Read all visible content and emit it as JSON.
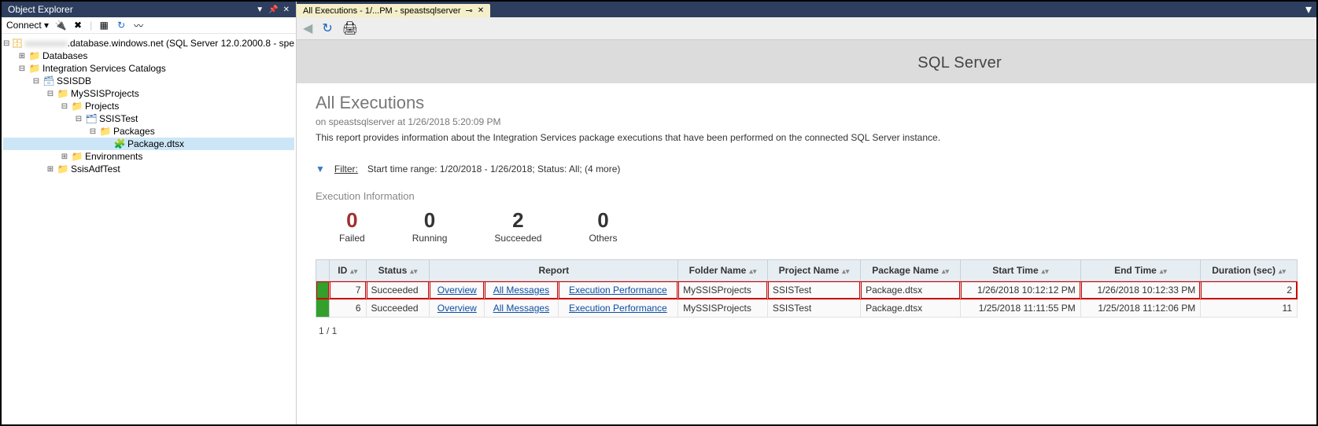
{
  "objectExplorer": {
    "title": "Object Explorer",
    "connectLabel": "Connect",
    "server": ".database.windows.net (SQL Server 12.0.2000.8 - spe",
    "nodes": {
      "databases": "Databases",
      "isc": "Integration Services Catalogs",
      "ssisdb": "SSISDB",
      "myproj": "MySSISProjects",
      "projects": "Projects",
      "ssistest": "SSISTest",
      "packages": "Packages",
      "packagedtsx": "Package.dtsx",
      "environments": "Environments",
      "ssisadftest": "SsisAdfTest"
    }
  },
  "tab": {
    "label": "All Executions - 1/...PM - speastsqlserver"
  },
  "brand": "SQL Server",
  "report": {
    "title": "All Executions",
    "subtitle": "on speastsqlserver at 1/26/2018 5:20:09 PM",
    "description": "This report provides information about the Integration Services package executions that have been performed on the connected SQL Server instance.",
    "filterLabel": "Filter:",
    "filterText": "Start time range: 1/20/2018 - 1/26/2018;  Status: All;  (4 more)",
    "sectionTitle": "Execution Information",
    "counters": {
      "failed": {
        "value": "0",
        "label": "Failed"
      },
      "running": {
        "value": "0",
        "label": "Running"
      },
      "succeeded": {
        "value": "2",
        "label": "Succeeded"
      },
      "others": {
        "value": "0",
        "label": "Others"
      }
    },
    "columns": {
      "id": "ID",
      "status": "Status",
      "report": "Report",
      "folder": "Folder Name",
      "project": "Project Name",
      "package": "Package Name",
      "start": "Start Time",
      "end": "End Time",
      "duration": "Duration (sec)"
    },
    "links": {
      "overview": "Overview",
      "allmsg": "All Messages",
      "execperf": "Execution Performance"
    },
    "rows": [
      {
        "id": "7",
        "status": "Succeeded",
        "folder": "MySSISProjects",
        "project": "SSISTest",
        "package": "Package.dtsx",
        "start": "1/26/2018 10:12:12 PM",
        "end": "1/26/2018 10:12:33 PM",
        "duration": "2"
      },
      {
        "id": "6",
        "status": "Succeeded",
        "folder": "MySSISProjects",
        "project": "SSISTest",
        "package": "Package.dtsx",
        "start": "1/25/2018 11:11:55 PM",
        "end": "1/25/2018 11:12:06 PM",
        "duration": "11"
      }
    ],
    "pager": "1 / 1"
  },
  "chart_data": {
    "type": "table",
    "title": "All Executions",
    "columns": [
      "ID",
      "Status",
      "Folder Name",
      "Project Name",
      "Package Name",
      "Start Time",
      "End Time",
      "Duration (sec)"
    ],
    "rows": [
      [
        7,
        "Succeeded",
        "MySSISProjects",
        "SSISTest",
        "Package.dtsx",
        "1/26/2018 10:12:12 PM",
        "1/26/2018 10:12:33 PM",
        2
      ],
      [
        6,
        "Succeeded",
        "MySSISProjects",
        "SSISTest",
        "Package.dtsx",
        "1/25/2018 11:11:55 PM",
        "1/25/2018 11:12:06 PM",
        11
      ]
    ],
    "summary": {
      "Failed": 0,
      "Running": 0,
      "Succeeded": 2,
      "Others": 0
    }
  }
}
